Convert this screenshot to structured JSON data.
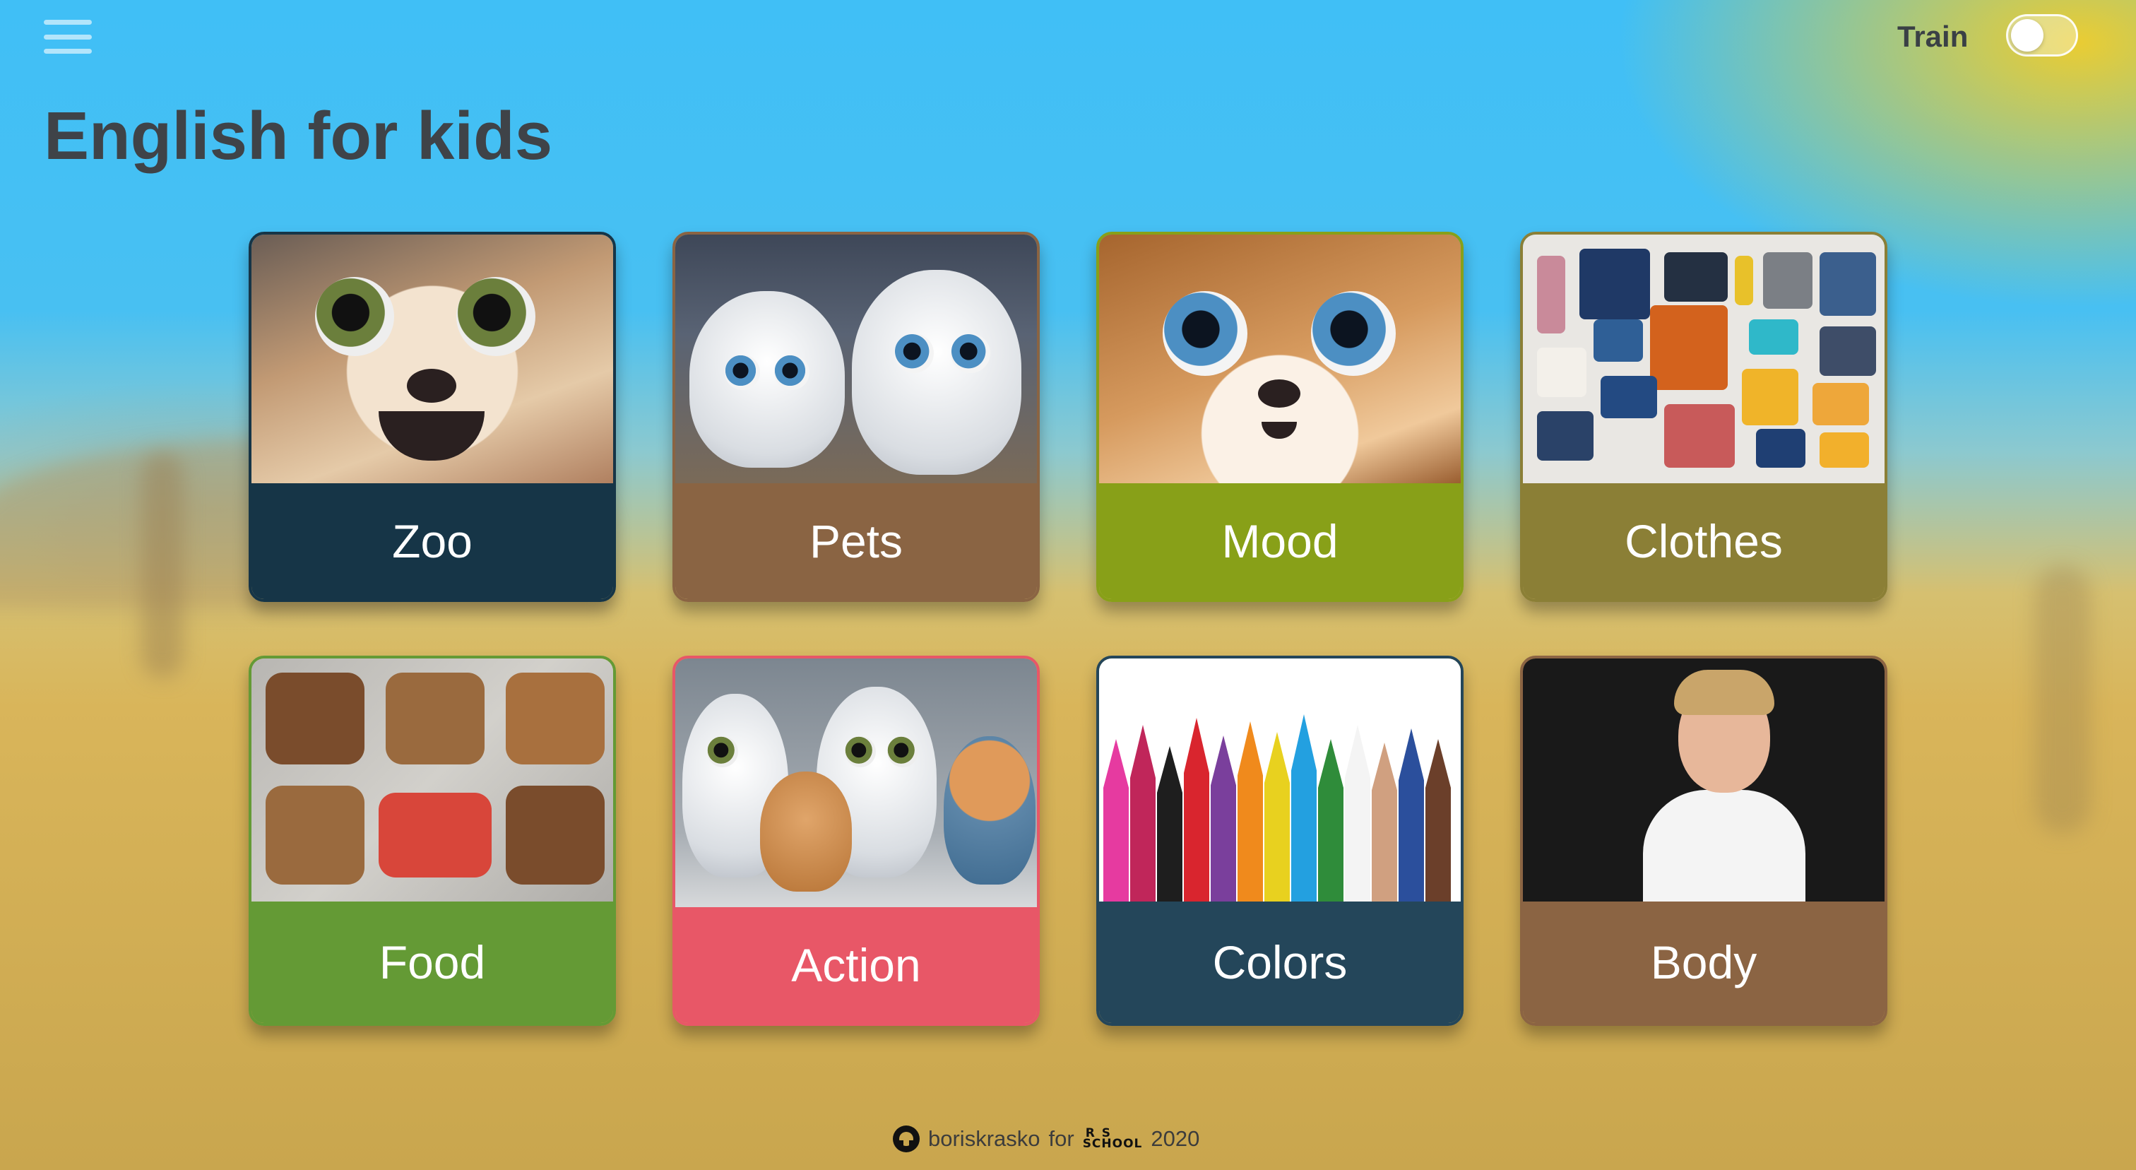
{
  "header": {
    "menu_icon": "hamburger-menu-icon",
    "mode_label": "Train",
    "mode_toggle_on": false
  },
  "page": {
    "title": "English for kids"
  },
  "categories": [
    {
      "label": "Zoo",
      "color": "#163547"
    },
    {
      "label": "Pets",
      "color": "#8a6443"
    },
    {
      "label": "Mood",
      "color": "#88a018"
    },
    {
      "label": "Clothes",
      "color": "#8b7f36"
    },
    {
      "label": "Food",
      "color": "#649a35"
    },
    {
      "label": "Action",
      "color": "#e85767"
    },
    {
      "label": "Colors",
      "color": "#24465a"
    },
    {
      "label": "Body",
      "color": "#8b6443"
    }
  ],
  "footer": {
    "github_icon": "github-icon",
    "author": "boriskrasko",
    "for_text": "for",
    "logo_top": "RS",
    "logo_bottom": "SCHOOL",
    "year": "2020"
  }
}
